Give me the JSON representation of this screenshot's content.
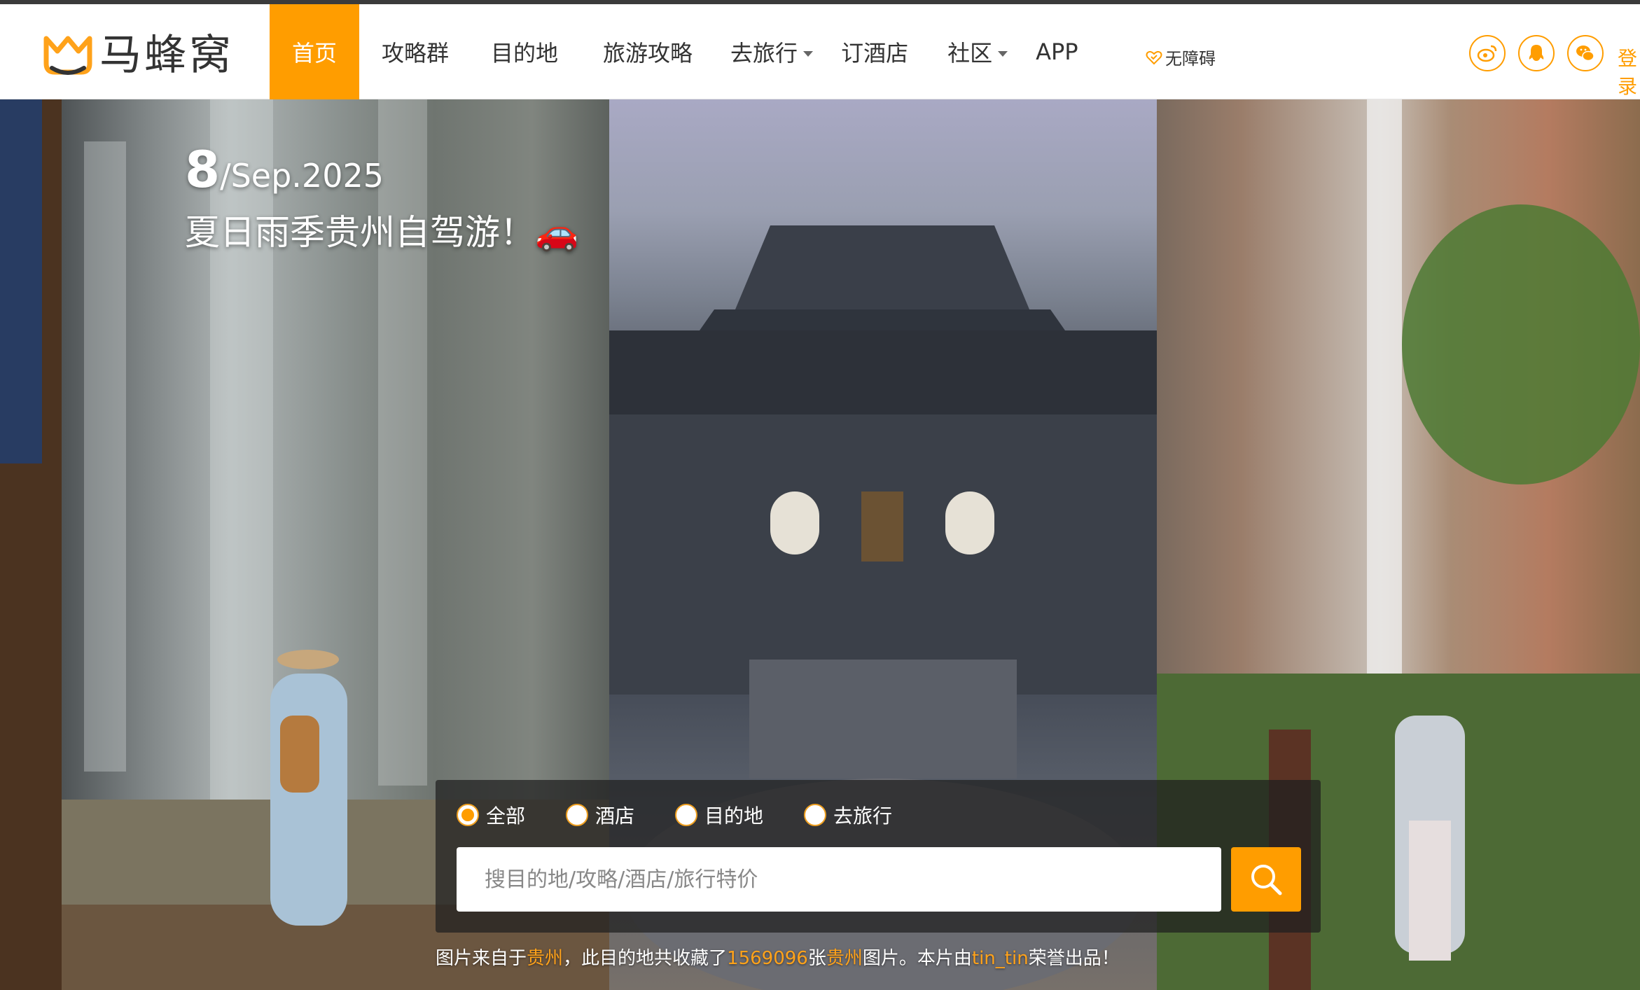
{
  "header": {
    "logo_text": "马蜂窝",
    "nav": [
      {
        "label": "首页",
        "active": true,
        "has_caret": false
      },
      {
        "label": "攻略群",
        "active": false,
        "has_caret": false
      },
      {
        "label": "目的地",
        "active": false,
        "has_caret": false
      },
      {
        "label": "旅游攻略",
        "active": false,
        "has_caret": false
      },
      {
        "label": "去旅行",
        "active": false,
        "has_caret": true
      },
      {
        "label": "订酒店",
        "active": false,
        "has_caret": false
      },
      {
        "label": "社区",
        "active": false,
        "has_caret": true
      },
      {
        "label": "APP",
        "active": false,
        "has_caret": false
      }
    ],
    "accessibility_label": "无障碍",
    "social_icons": [
      "weibo-icon",
      "qq-icon",
      "wechat-icon"
    ],
    "login_label": "登录"
  },
  "hero": {
    "date_day": "8",
    "date_rest": "/Sep.2025",
    "title": "夏日雨季贵州自驾游！🚗"
  },
  "search": {
    "options": [
      {
        "label": "全部",
        "selected": true
      },
      {
        "label": "酒店",
        "selected": false
      },
      {
        "label": "目的地",
        "selected": false
      },
      {
        "label": "去旅行",
        "selected": false
      }
    ],
    "placeholder": "搜目的地/攻略/酒店/旅行特价"
  },
  "credit": {
    "prefix": "图片来自于",
    "place": "贵州",
    "middle": "，此目的地共收藏了",
    "count": "1569096",
    "unit": "张",
    "place2": "贵州",
    "after": "图片。本片由",
    "author": "tin_tin",
    "suffix": "荣誉出品！"
  },
  "colors": {
    "accent": "#ff9d00",
    "header_bg": "#ffffff",
    "text": "#333333",
    "search_panel": "rgba(30,30,30,0.72)"
  }
}
